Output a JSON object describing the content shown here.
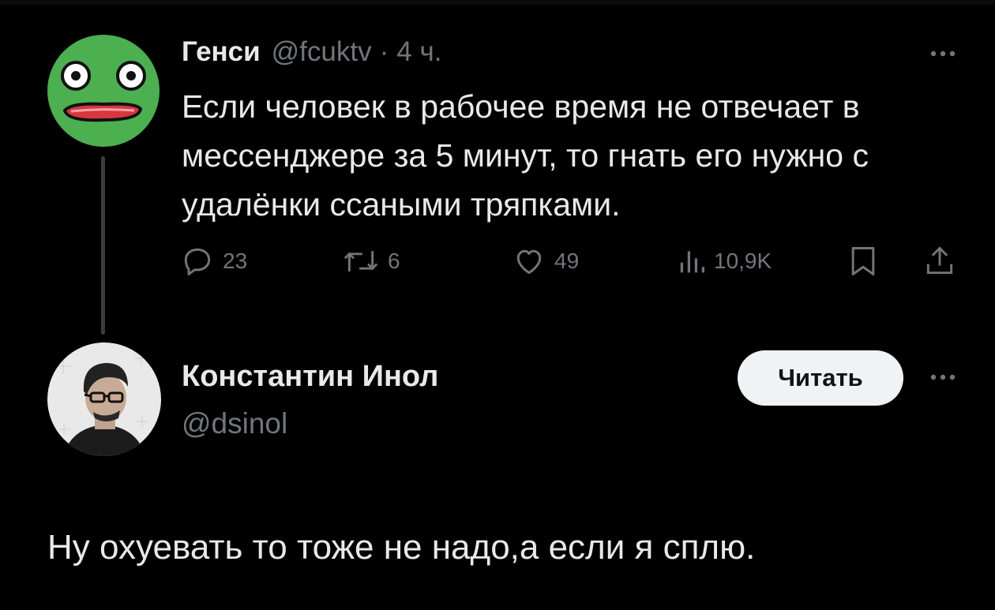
{
  "tweet": {
    "author_name": "Генси",
    "handle": "@fcuktv",
    "separator": "·",
    "time": "4 ч.",
    "text": "Если человек в рабочее время не отвечает в мессенджере за 5 минут, то гнать его нужно с удалёнки ссаными тряпками.",
    "more_icon": "more-horizontal-icon",
    "actions": {
      "replies": "23",
      "retweets": "6",
      "likes": "49",
      "views": "10,9K"
    },
    "avatar_color": "#4caf50"
  },
  "profile": {
    "name": "Константин Инол",
    "handle": "@dsinol",
    "follow_label": "Читать"
  },
  "reply": {
    "text": "Ну охуевать то тоже не надо,а если я сплю."
  },
  "colors": {
    "background": "#000000",
    "primary_text": "#e7e9ea",
    "secondary_text": "#71767b",
    "button_bg": "#eff3f4"
  }
}
